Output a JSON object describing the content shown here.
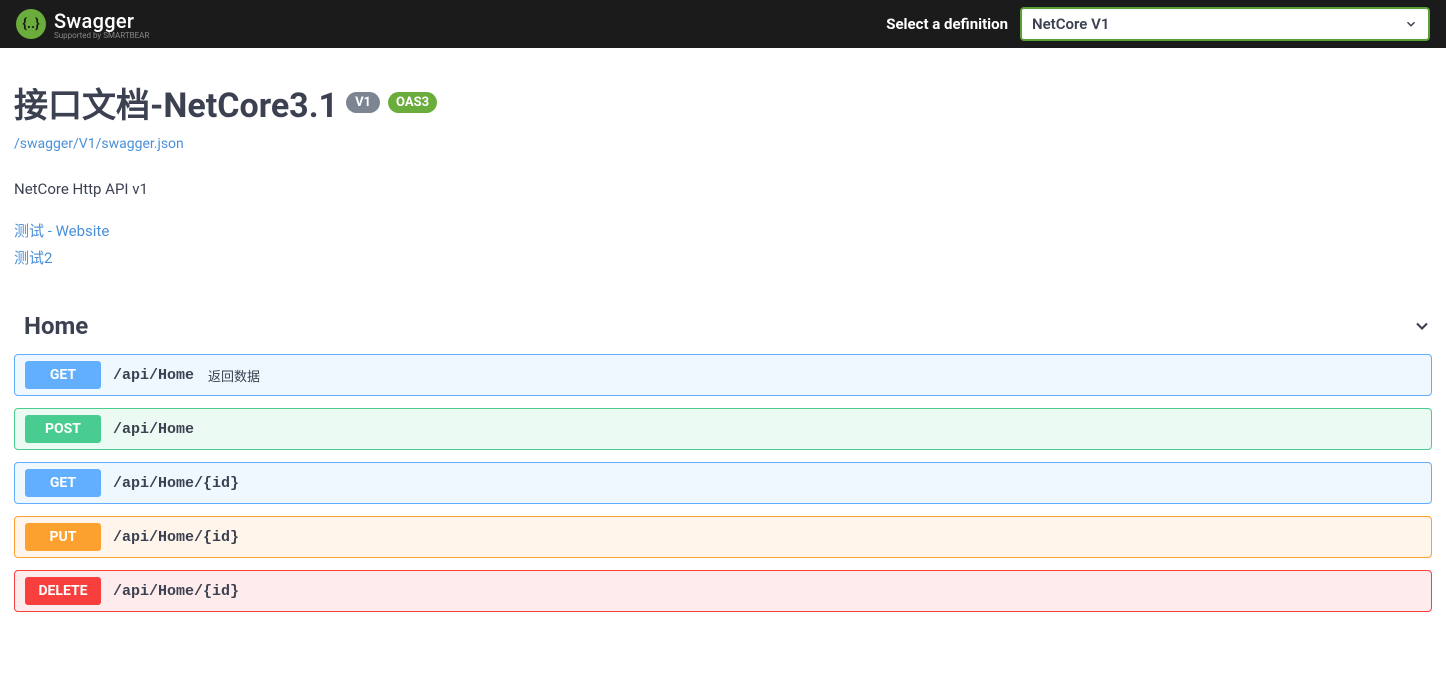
{
  "topbar": {
    "logo_text": "Swagger",
    "logo_sub": "Supported by SMARTBEAR",
    "definition_label": "Select a definition",
    "definition_selected": "NetCore V1"
  },
  "info": {
    "title": "接口文档-NetCore3.1",
    "version_badge": "V1",
    "oas_badge": "OAS3",
    "spec_url": "/swagger/V1/swagger.json",
    "description": "NetCore Http API v1",
    "contacts": [
      {
        "label": "测试 - Website"
      },
      {
        "label": "测试2"
      }
    ]
  },
  "tag": {
    "name": "Home",
    "operations": [
      {
        "method": "GET",
        "method_class": "get",
        "path": "/api/Home",
        "summary": "返回数据"
      },
      {
        "method": "POST",
        "method_class": "post",
        "path": "/api/Home",
        "summary": ""
      },
      {
        "method": "GET",
        "method_class": "get",
        "path": "/api/Home/{id}",
        "summary": ""
      },
      {
        "method": "PUT",
        "method_class": "put",
        "path": "/api/Home/{id}",
        "summary": ""
      },
      {
        "method": "DELETE",
        "method_class": "delete",
        "path": "/api/Home/{id}",
        "summary": ""
      }
    ]
  }
}
